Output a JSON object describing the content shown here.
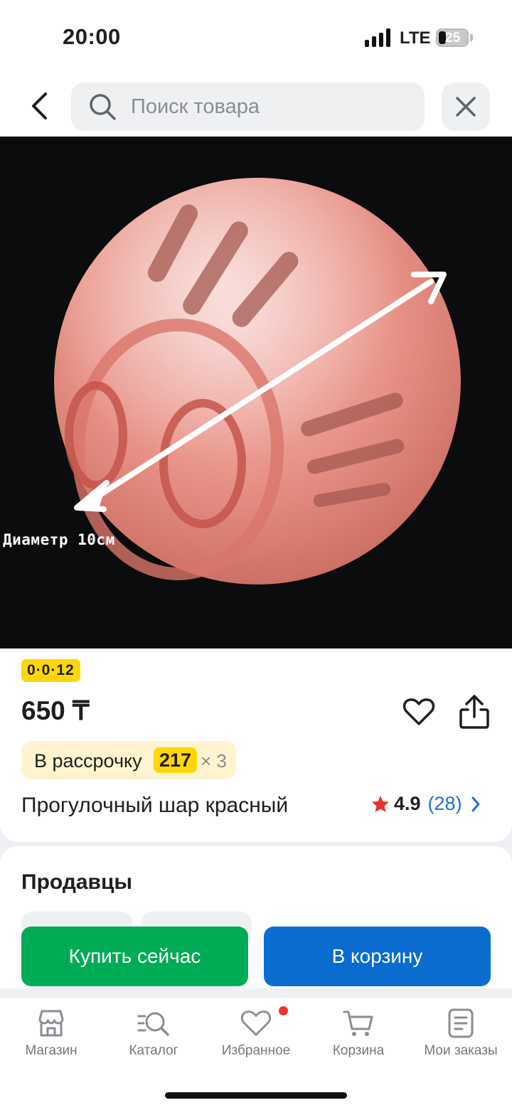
{
  "status_bar": {
    "time": "20:00",
    "network": "LTE",
    "battery": "25"
  },
  "search": {
    "placeholder": "Поиск товара"
  },
  "product": {
    "image_caption": "Диаметр 10см",
    "promo_badge": "0·0·12",
    "price": "650 ₸",
    "installment": {
      "label": "В рассрочку",
      "amount": "217",
      "multiplier": "× 3"
    },
    "title": "Прогулочный шар красный",
    "rating": {
      "value": "4.9",
      "count": "(28)"
    }
  },
  "sellers": {
    "heading": "Продавцы"
  },
  "actions": {
    "buy_now": "Купить сейчас",
    "add_to_cart": "В корзину"
  },
  "bottom_nav": [
    {
      "label": "Магазин",
      "icon": "store-icon"
    },
    {
      "label": "Каталог",
      "icon": "catalog-search-icon"
    },
    {
      "label": "Избранное",
      "icon": "heart-icon"
    },
    {
      "label": "Корзина",
      "icon": "cart-icon"
    },
    {
      "label": "Мои заказы",
      "icon": "orders-icon"
    }
  ],
  "colors": {
    "buy_green": "#00ab55",
    "cart_blue": "#0a6ccf",
    "promo_yellow": "#ffd60a",
    "rating_star": "#e8322a",
    "link_blue": "#1d6fd6"
  }
}
